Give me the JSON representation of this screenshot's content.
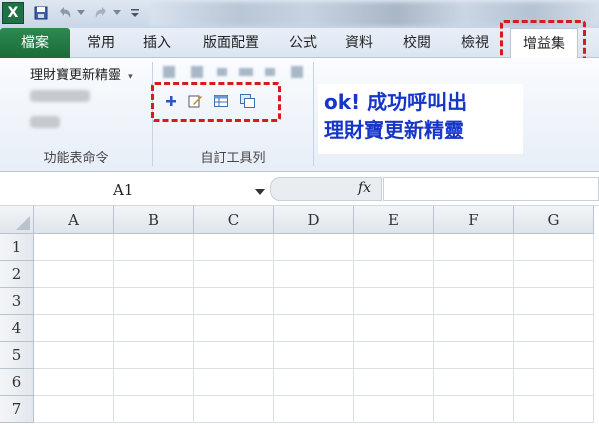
{
  "tabs": [
    {
      "id": "file",
      "label": "檔案"
    },
    {
      "id": "home",
      "label": "常用"
    },
    {
      "id": "insert",
      "label": "插入"
    },
    {
      "id": "layout",
      "label": "版面配置"
    },
    {
      "id": "formulas",
      "label": "公式"
    },
    {
      "id": "data",
      "label": "資料"
    },
    {
      "id": "review",
      "label": "校閱"
    },
    {
      "id": "view",
      "label": "檢視"
    },
    {
      "id": "addins",
      "label": "增益集"
    }
  ],
  "ribbon": {
    "menu_command_label": "理財寶更新精靈",
    "menu_group_label": "功能表命令",
    "toolbar_group_label": "自訂工具列"
  },
  "annotation": {
    "line1": "ok!  成功呼叫出",
    "line2": "理財寶更新精靈"
  },
  "formula_bar": {
    "name_box": "A1",
    "fx_label": "fx",
    "formula": ""
  },
  "sheet": {
    "columns": [
      "A",
      "B",
      "C",
      "D",
      "E",
      "F",
      "G"
    ],
    "rows": [
      "1",
      "2",
      "3",
      "4",
      "5",
      "6",
      "7"
    ]
  },
  "colors": {
    "file_tab": "#1e7145",
    "callout": "#d71920",
    "annotation_text": "#1636c8"
  }
}
